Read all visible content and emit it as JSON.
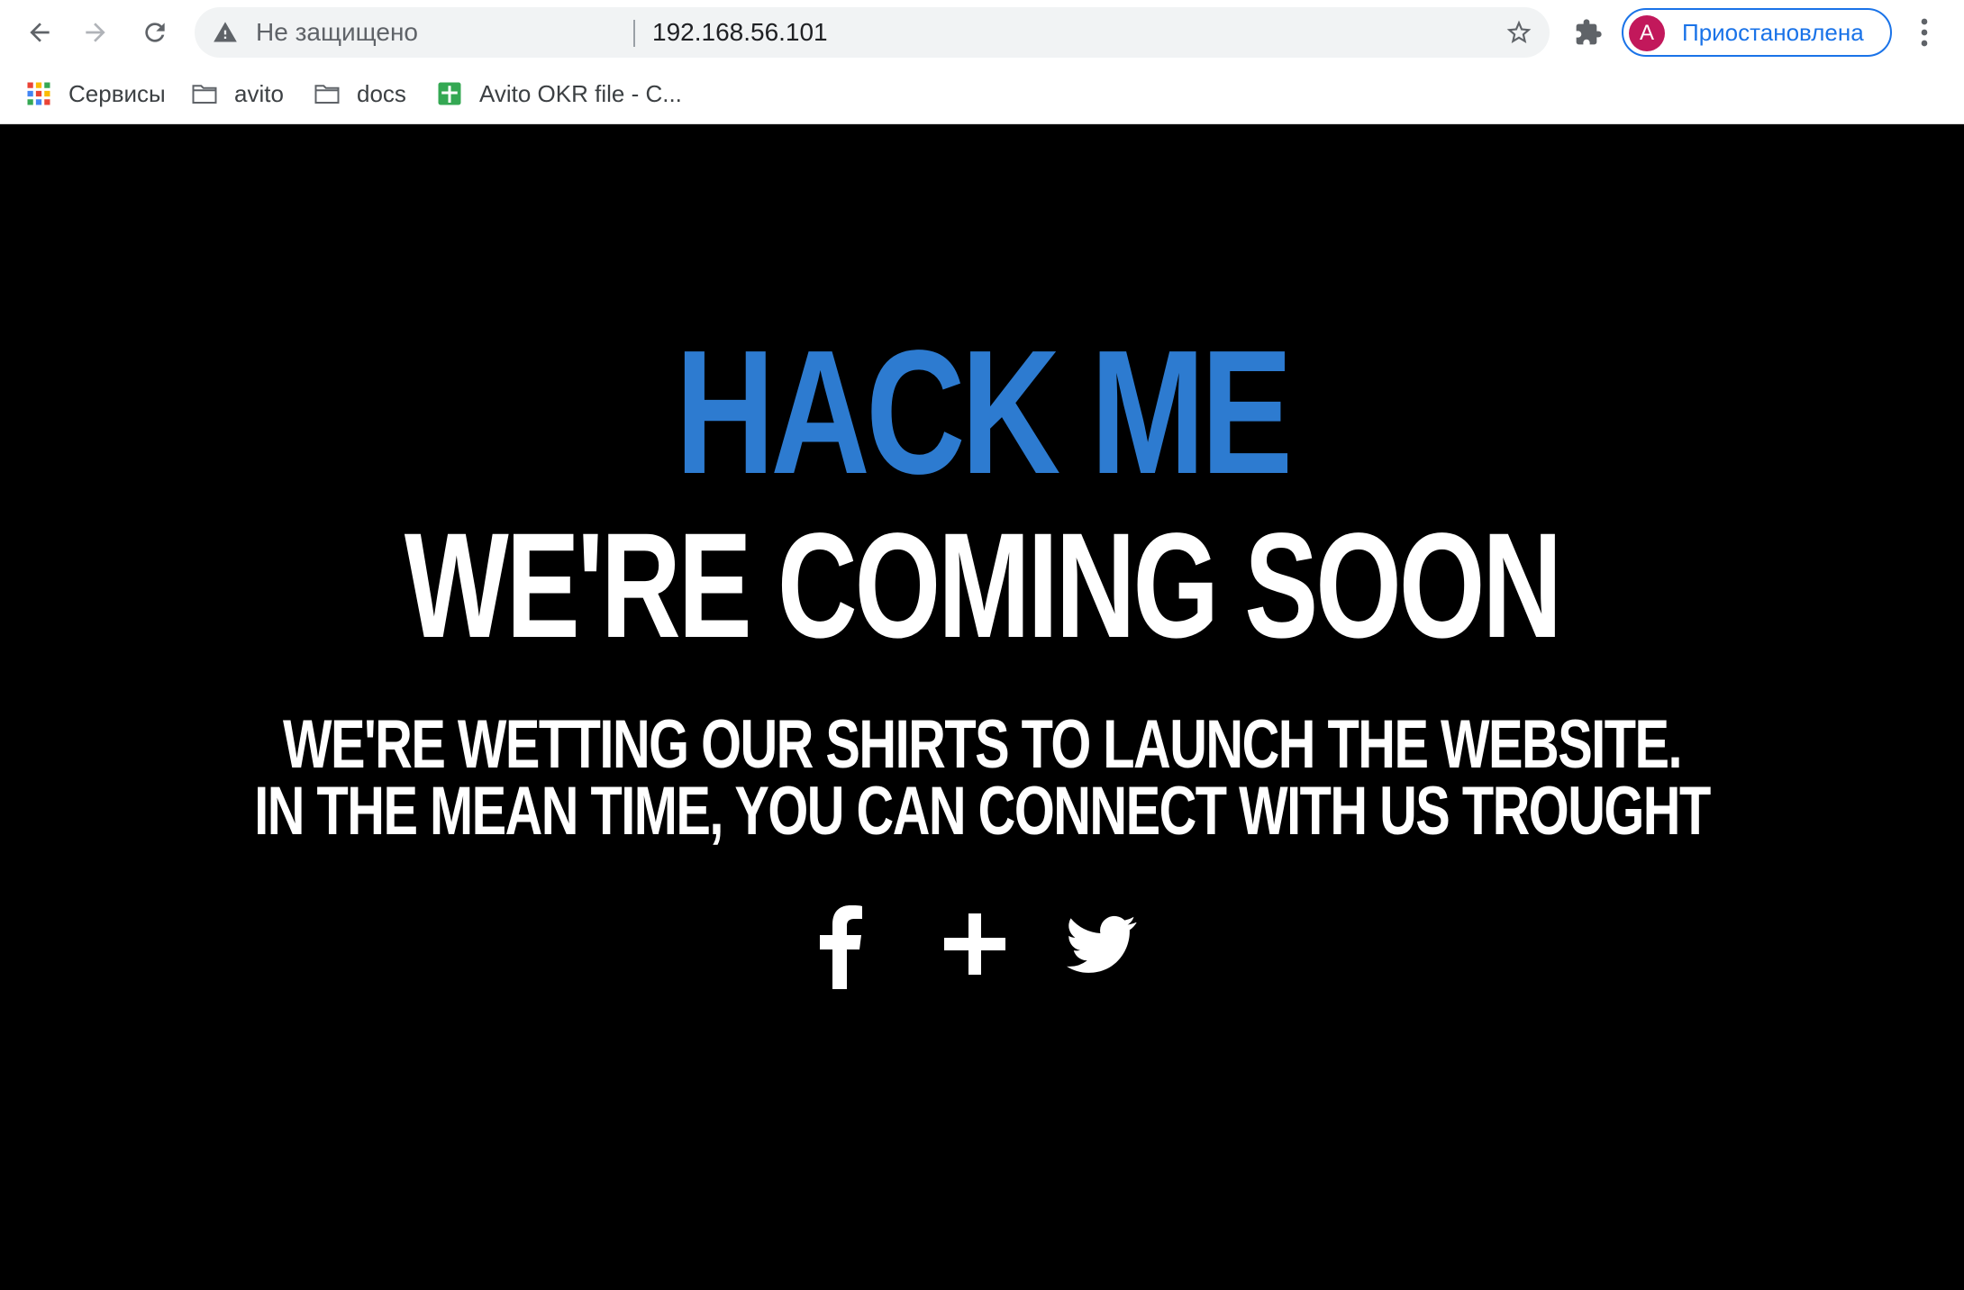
{
  "browser": {
    "security_label": "Не защищено",
    "url": "192.168.56.101",
    "profile": {
      "initial": "A",
      "status": "Приостановлена",
      "avatar_color": "#c2185b"
    },
    "bookmarks": [
      {
        "label": "Сервисы",
        "icon": "apps-grid-icon"
      },
      {
        "label": "avito",
        "icon": "folder-icon"
      },
      {
        "label": "docs",
        "icon": "folder-icon"
      },
      {
        "label": "Avito OKR file - C...",
        "icon": "google-sheets-icon"
      }
    ]
  },
  "page": {
    "title": "HACK ME",
    "headline": "WE'RE COMING SOON",
    "message_lines": [
      "WE'RE WETTING OUR SHIRTS TO LAUNCH THE WEBSITE.",
      "IN THE MEAN TIME, YOU CAN CONNECT WITH US TROUGHT"
    ],
    "social_links": [
      "facebook-icon",
      "google-plus-icon",
      "twitter-icon"
    ],
    "colors": {
      "background": "#000000",
      "title": "#2d7bd0",
      "text": "#ffffff"
    }
  }
}
